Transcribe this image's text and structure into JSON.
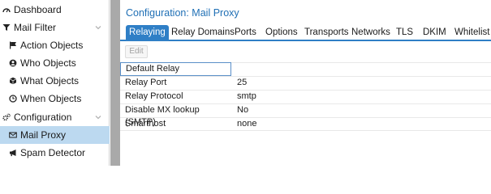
{
  "sidebar": {
    "items": [
      {
        "label": "Dashboard",
        "icon": "dashboard-icon"
      },
      {
        "label": "Mail Filter",
        "icon": "filter-icon",
        "chevron": true
      },
      {
        "label": "Action Objects",
        "icon": "flag-icon"
      },
      {
        "label": "Who Objects",
        "icon": "user-icon"
      },
      {
        "label": "What Objects",
        "icon": "cube-icon"
      },
      {
        "label": "When Objects",
        "icon": "clock-icon"
      },
      {
        "label": "Configuration",
        "icon": "cogs-icon",
        "chevron": true
      },
      {
        "label": "Mail Proxy",
        "icon": "envelope-icon"
      },
      {
        "label": "Spam Detector",
        "icon": "bullhorn-icon"
      }
    ]
  },
  "main": {
    "title": "Configuration: Mail Proxy",
    "tabs": [
      {
        "label": "Relaying"
      },
      {
        "label": "Relay Domains"
      },
      {
        "label": "Ports"
      },
      {
        "label": "Options"
      },
      {
        "label": "Transports"
      },
      {
        "label": "Networks"
      },
      {
        "label": "TLS"
      },
      {
        "label": "DKIM"
      },
      {
        "label": "Whitelist"
      }
    ],
    "active_tab": "Relaying",
    "toolbar": {
      "edit_label": "Edit"
    },
    "rows": [
      {
        "name": "Default Relay",
        "value": ""
      },
      {
        "name": "Relay Port",
        "value": "25"
      },
      {
        "name": "Relay Protocol",
        "value": "smtp"
      },
      {
        "name": "Disable MX lookup (SMTP)",
        "value": "No"
      },
      {
        "name": "Smarthost",
        "value": "none"
      }
    ]
  },
  "colors": {
    "accent": "#2f7fc6",
    "title": "#1f6fb5",
    "sidebar_selected": "#bcd9f0",
    "divider": "#a9a9a9"
  }
}
